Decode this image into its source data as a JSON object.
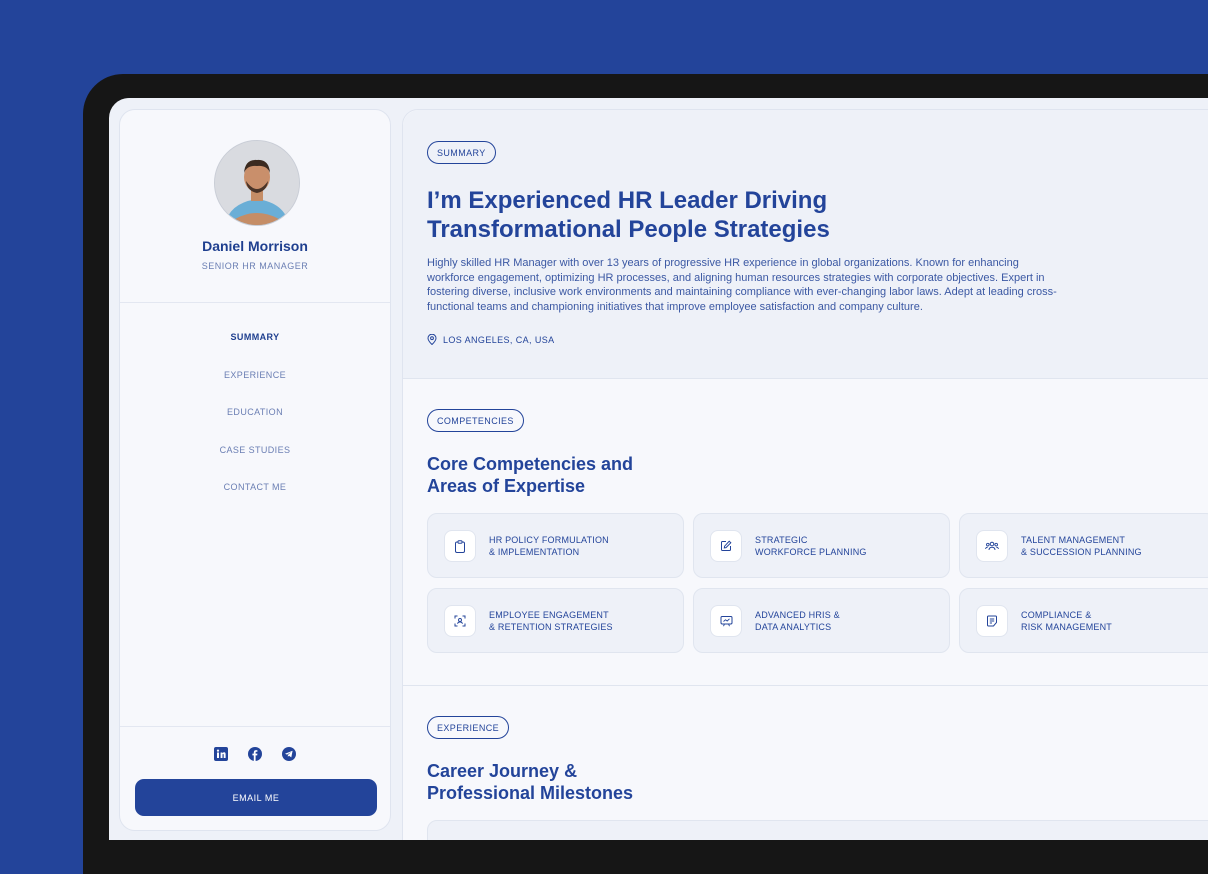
{
  "profile": {
    "name": "Daniel Morrison",
    "role": "SENIOR HR MANAGER"
  },
  "nav": [
    {
      "label": "SUMMARY",
      "active": true
    },
    {
      "label": "EXPERIENCE",
      "active": false
    },
    {
      "label": "EDUCATION",
      "active": false
    },
    {
      "label": "CASE STUDIES",
      "active": false
    },
    {
      "label": "CONTACT ME",
      "active": false
    }
  ],
  "socials": [
    "linkedin-icon",
    "facebook-icon",
    "telegram-icon"
  ],
  "email_button": "EMAIL ME",
  "summary": {
    "tag": "SUMMARY",
    "title": "I’m Experienced HR Leader Driving Transformational People Strategies",
    "intro": "Highly skilled HR Manager with over 13 years of progressive HR experience in global organizations. Known for enhancing workforce engagement, optimizing HR processes, and aligning human resources strategies with corporate objectives. Expert in fostering diverse, inclusive work environments and maintaining compliance with ever-changing labor laws. Adept at leading cross-functional teams and championing initiatives that improve employee satisfaction and company culture.",
    "location": "LOS ANGELES, CA, USA"
  },
  "competencies": {
    "tag": "COMPETENCIES",
    "title": "Core Competencies and Areas of Expertise",
    "items": [
      {
        "icon": "clipboard-icon",
        "label": "HR POLICY FORMULATION\n& IMPLEMENTATION"
      },
      {
        "icon": "edit-icon",
        "label": "STRATEGIC\nWORKFORCE PLANNING"
      },
      {
        "icon": "people-icon",
        "label": "TALENT MANAGEMENT\n& SUCCESSION PLANNING"
      },
      {
        "icon": "user-focus-icon",
        "label": "EMPLOYEE ENGAGEMENT\n& RETENTION STRATEGIES"
      },
      {
        "icon": "chart-board-icon",
        "label": "ADVANCED HRIS &\nDATA ANALYTICS"
      },
      {
        "icon": "document-icon",
        "label": "COMPLIANCE &\nRISK MANAGEMENT"
      }
    ]
  },
  "experience": {
    "tag": "EXPERIENCE",
    "title": "Career Journey & Professional Milestones"
  },
  "colors": {
    "background": "#23449a",
    "accent": "#23449a",
    "text": "#1f3f8f",
    "muted": "#6a7eb3"
  }
}
